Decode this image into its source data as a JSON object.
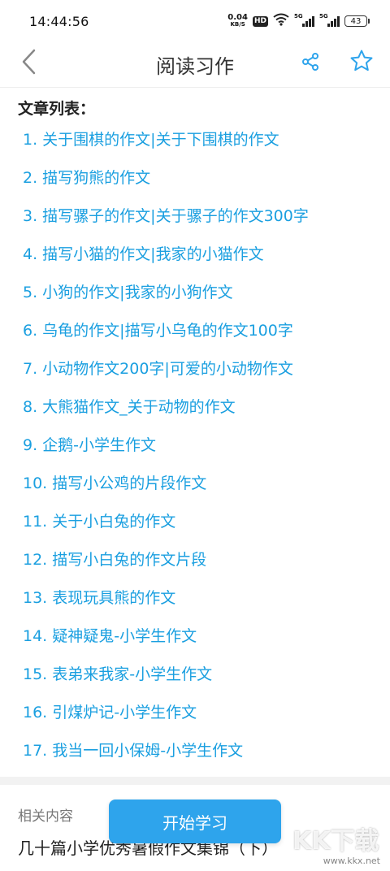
{
  "status_bar": {
    "time": "14:44:56",
    "net_speed_value": "0.04",
    "net_speed_unit": "KB/S",
    "hd_label": "HD",
    "signal1_label": "5G",
    "signal2_label": "5G",
    "battery": "43"
  },
  "header": {
    "title": "阅读习作"
  },
  "section": {
    "title": "文章列表："
  },
  "articles": [
    "1. 关于围棋的作文|关于下围棋的作文",
    "2. 描写狗熊的作文",
    "3. 描写骡子的作文|关于骡子的作文300字",
    "4. 描写小猫的作文|我家的小猫作文",
    "5. 小狗的作文|我家的小狗作文",
    "6. 乌龟的作文|描写小乌龟的作文100字",
    "7. 小动物作文200字|可爱的小动物作文",
    "8. 大熊猫作文_关于动物的作文",
    "9. 企鹅-小学生作文",
    "10. 描写小公鸡的片段作文",
    "11. 关于小白兔的作文",
    "12. 描写小白兔的作文片段",
    "13. 表现玩具熊的作文",
    "14. 疑神疑鬼-小学生作文",
    "15. 表弟来我家-小学生作文",
    "16. 引煤炉记-小学生作文",
    "17. 我当一回小保姆-小学生作文"
  ],
  "related": {
    "title": "相关内容",
    "first_item": "几十篇小学优秀暑假作文集锦（下）"
  },
  "start_button_label": "开始学习",
  "watermark": {
    "big": "KK下载",
    "small": "www.kkx.net"
  },
  "colors": {
    "accent": "#2ea4ec",
    "link": "#1a9fe0"
  }
}
